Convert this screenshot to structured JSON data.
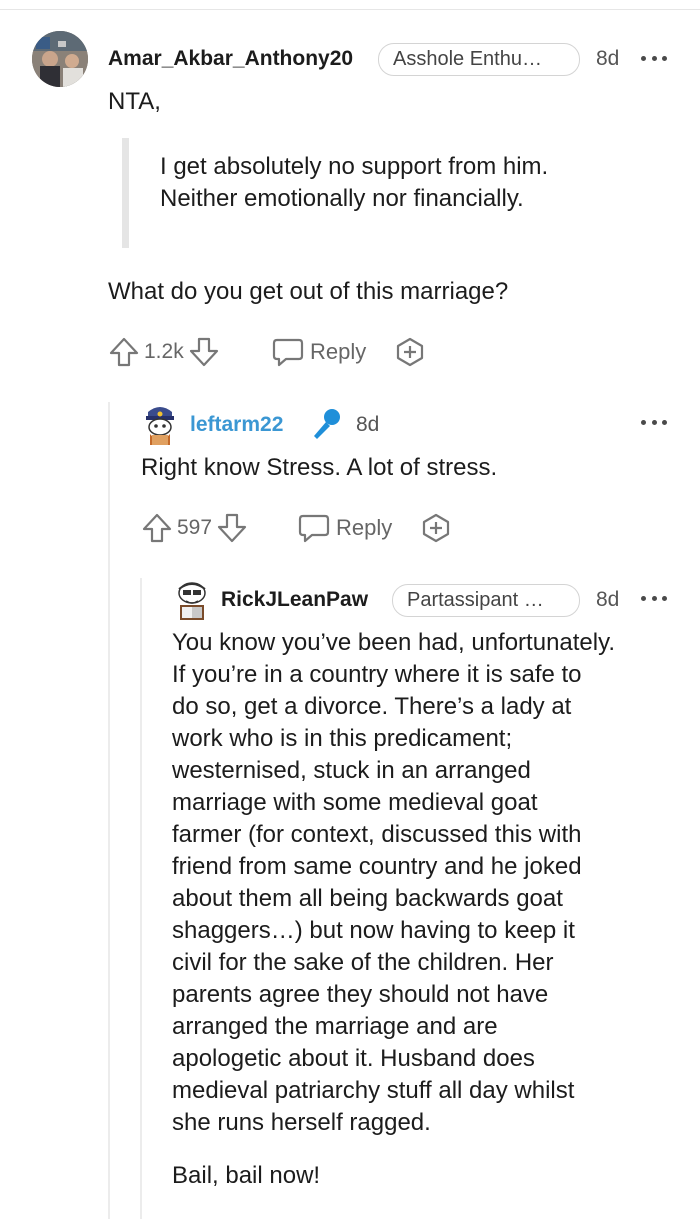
{
  "comment1": {
    "username": "Amar_Akbar_Anthony20",
    "flair": "Asshole Enthu…",
    "age": "8d",
    "text_first": "NTA,",
    "quote_line1": "I get absolutely no support from him.",
    "quote_line2": "Neither emotionally nor financially.",
    "text_last": "What do you get out of this marriage?",
    "votes": "1.2k",
    "reply_label": "Reply"
  },
  "comment2": {
    "username": "leftarm22",
    "age": "8d",
    "text": "Right know Stress. A lot of stress.",
    "votes": "597",
    "reply_label": "Reply",
    "username_color": "#3b97d3"
  },
  "comment3": {
    "username": "RickJLeanPaw",
    "flair": "Partassipant …",
    "age": "8d",
    "lines": [
      "You know you’ve been had, unfortunately.",
      "If you’re in a country where it is safe to",
      "do so, get a divorce. There’s a lady at",
      "work who is in this predicament;",
      "westernised, stuck in an arranged",
      "marriage with some medieval goat",
      "farmer (for context, discussed this with",
      "friend from same country and he joked",
      "about them all being backwards goat",
      "shaggers…) but now having to keep it",
      "civil for the sake of the children. Her",
      "parents agree they should not have",
      "arranged the marriage and are",
      "apologetic about it. Husband does",
      "medieval patriarchy stuff all day whilst",
      "she runs herself ragged."
    ],
    "closing": "Bail, bail now!"
  },
  "icons": {
    "upvote": "upvote-arrow-icon",
    "downvote": "downvote-arrow-icon",
    "reply": "speech-bubble-icon",
    "award": "award-plus-icon",
    "more": "more-dots-icon",
    "mic": "microphone-icon"
  }
}
